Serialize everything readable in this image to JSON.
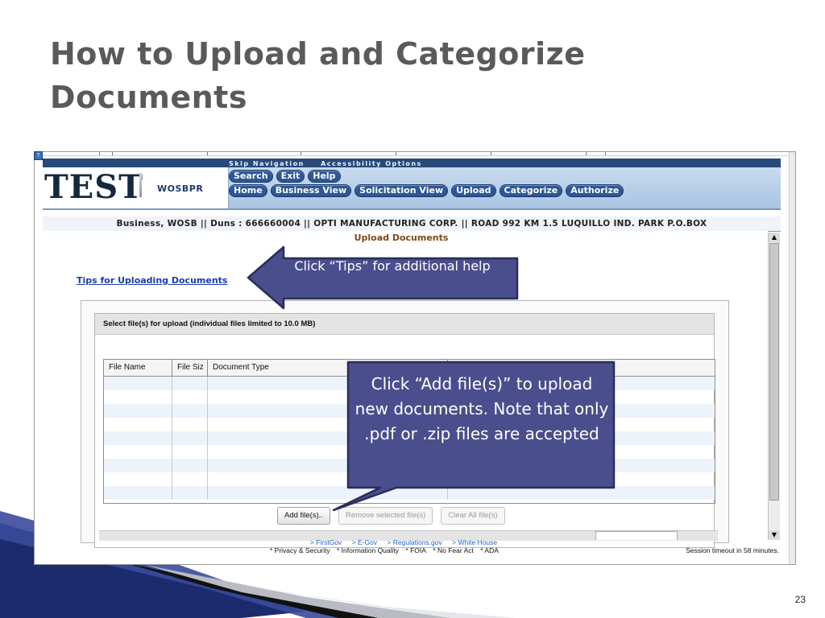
{
  "slide": {
    "title_line1": "How to Upload and Categorize",
    "title_line2": "Documents",
    "page_number": "23"
  },
  "app": {
    "logo": "TEST",
    "system": "WOSBPR",
    "skip_nav": [
      "Skip Navigation",
      "Accessibility Options"
    ],
    "nav_row1": [
      "Search",
      "Exit",
      "Help"
    ],
    "nav_row2": [
      "Home",
      "Business View",
      "Solicitation View",
      "Upload",
      "Categorize",
      "Authorize"
    ],
    "info_bar": "Business, WOSB || Duns : 666660004 || OPTI MANUFACTURING CORP. || ROAD 992 KM 1.5 LUQUILLO IND. PARK P.O.BOX",
    "page_heading": "Upload Documents",
    "tips_link": "Tips for Uploading Documents",
    "upload_panel": {
      "header": "Select file(s) for upload (individual files limited to 10.0 MB)",
      "columns": [
        "File Name",
        "File Siz",
        "Document Type",
        ""
      ],
      "rows": 9
    },
    "buttons": {
      "add": "Add file(s)..",
      "remove": "Remove selected file(s)",
      "clear": "Clear All file(s)"
    },
    "footer": {
      "links": [
        "> FirstGov",
        "> E-Gov",
        "> Regulations.gov",
        "> White House"
      ],
      "policies": [
        "* Privacy & Security",
        "* Information Quality",
        "* FOIA",
        "* No Fear Act",
        "* ADA"
      ],
      "session": "Session timeout in 58 minutes."
    }
  },
  "callouts": {
    "tips": "Click “Tips” for additional help",
    "add": "Click “Add file(s)” to upload new documents. Note that only .pdf or .zip files are accepted"
  },
  "colors": {
    "callout_fill": "#4b4e8c",
    "callout_border": "#2a2d5a",
    "title_gray": "#5a5a5a",
    "nav_blue": "#2d5796",
    "deco_navy": "#1c2a6e"
  }
}
